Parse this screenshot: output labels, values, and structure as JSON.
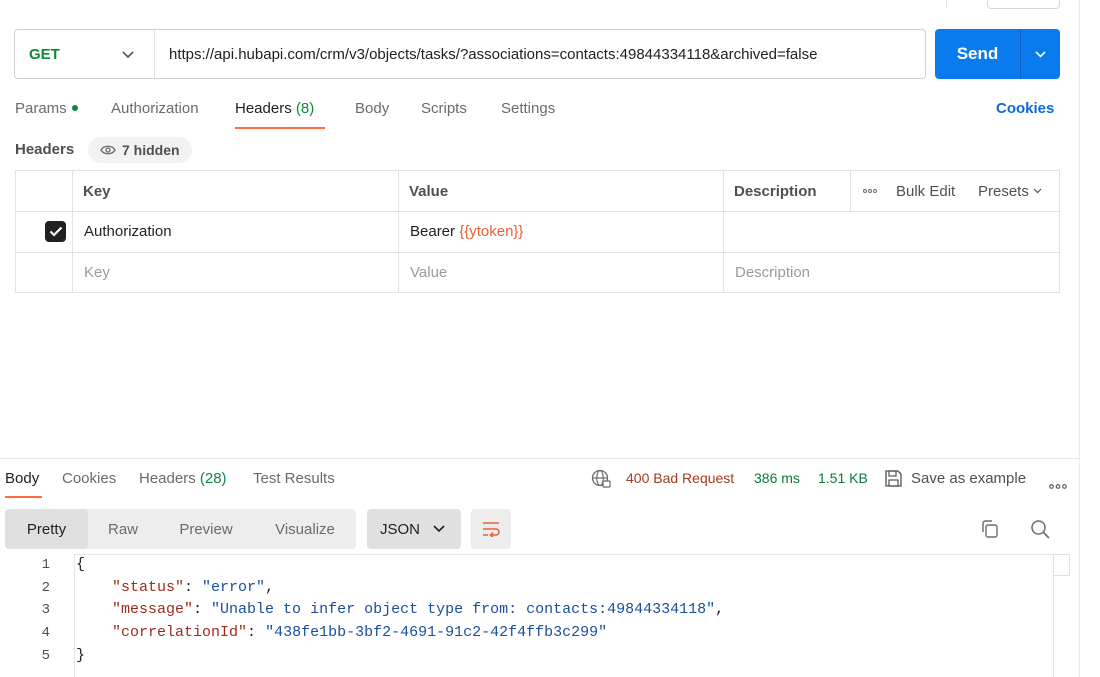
{
  "request": {
    "method": "GET",
    "url": "https://api.hubapi.com/crm/v3/objects/tasks/?associations=contacts:49844334118&archived=false",
    "send_label": "Send"
  },
  "request_tabs": [
    {
      "label": "Params"
    },
    {
      "label": "Authorization"
    },
    {
      "label": "Headers",
      "count": "(8)"
    },
    {
      "label": "Body"
    },
    {
      "label": "Scripts"
    },
    {
      "label": "Settings"
    }
  ],
  "cookies_link": "Cookies",
  "headers_section": {
    "title": "Headers",
    "hidden_label": "7 hidden"
  },
  "headers_table": {
    "columns": {
      "key": "Key",
      "value": "Value",
      "description": "Description"
    },
    "bulk_edit": "Bulk Edit",
    "presets": "Presets",
    "rows": [
      {
        "checked": true,
        "key": "Authorization",
        "value_prefix": "Bearer ",
        "value_var": "{{ytoken}}",
        "description": ""
      }
    ],
    "placeholder": {
      "key": "Key",
      "value": "Value",
      "description": "Description"
    }
  },
  "response_tabs": [
    {
      "label": "Body"
    },
    {
      "label": "Cookies"
    },
    {
      "label": "Headers",
      "count": "(28)"
    },
    {
      "label": "Test Results"
    }
  ],
  "response_status": {
    "status": "400 Bad Request",
    "time": "386 ms",
    "size": "1.51 KB",
    "save_label": "Save as example"
  },
  "view_modes": [
    "Pretty",
    "Raw",
    "Preview",
    "Visualize"
  ],
  "format": "JSON",
  "code": {
    "line_numbers": [
      "1",
      "2",
      "3",
      "4",
      "5"
    ],
    "open_brace": "{",
    "close_brace": "}",
    "entries": [
      {
        "key": "\"status\"",
        "value": "\"error\"",
        "trail": ","
      },
      {
        "key": "\"message\"",
        "value": "\"Unable to infer object type from: contacts:49844334118\"",
        "trail": ","
      },
      {
        "key": "\"correlationId\"",
        "value": "\"438fe1bb-3bf2-4691-91c2-42f4ffb3c299\"",
        "trail": ""
      }
    ]
  },
  "colors": {
    "accent": "#ff6c37",
    "send": "#097bed",
    "method": "#0b8a3c",
    "error": "#a33b1f"
  }
}
